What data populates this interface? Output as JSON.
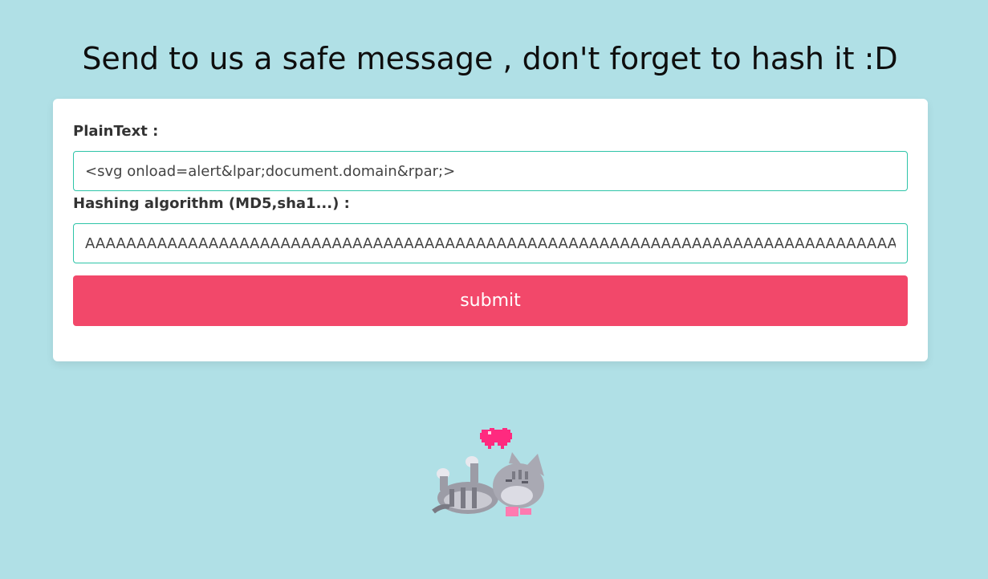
{
  "header": {
    "title": "Send to us a safe message , don't forget to hash it :D"
  },
  "form": {
    "plaintext_label": "PlainText :",
    "plaintext_value": "<svg onload=alert&lpar;document.domain&rpar;>",
    "hash_label": "Hashing algorithm (MD5,sha1...) :",
    "hash_value": "AAAAAAAAAAAAAAAAAAAAAAAAAAAAAAAAAAAAAAAAAAAAAAAAAAAAAAAAAAAAAAAAAAAAAAAAAAAAAAAAAAAAAAAAAAAAAAAAAAAAAAAAAAAAAAAAAAAAAAAAA",
    "submit_label": "submit"
  },
  "colors": {
    "background": "#b0e0e6",
    "accent": "#f2486a",
    "input_border": "#2ec4a8"
  },
  "decor": {
    "image": "cat-with-heart"
  }
}
